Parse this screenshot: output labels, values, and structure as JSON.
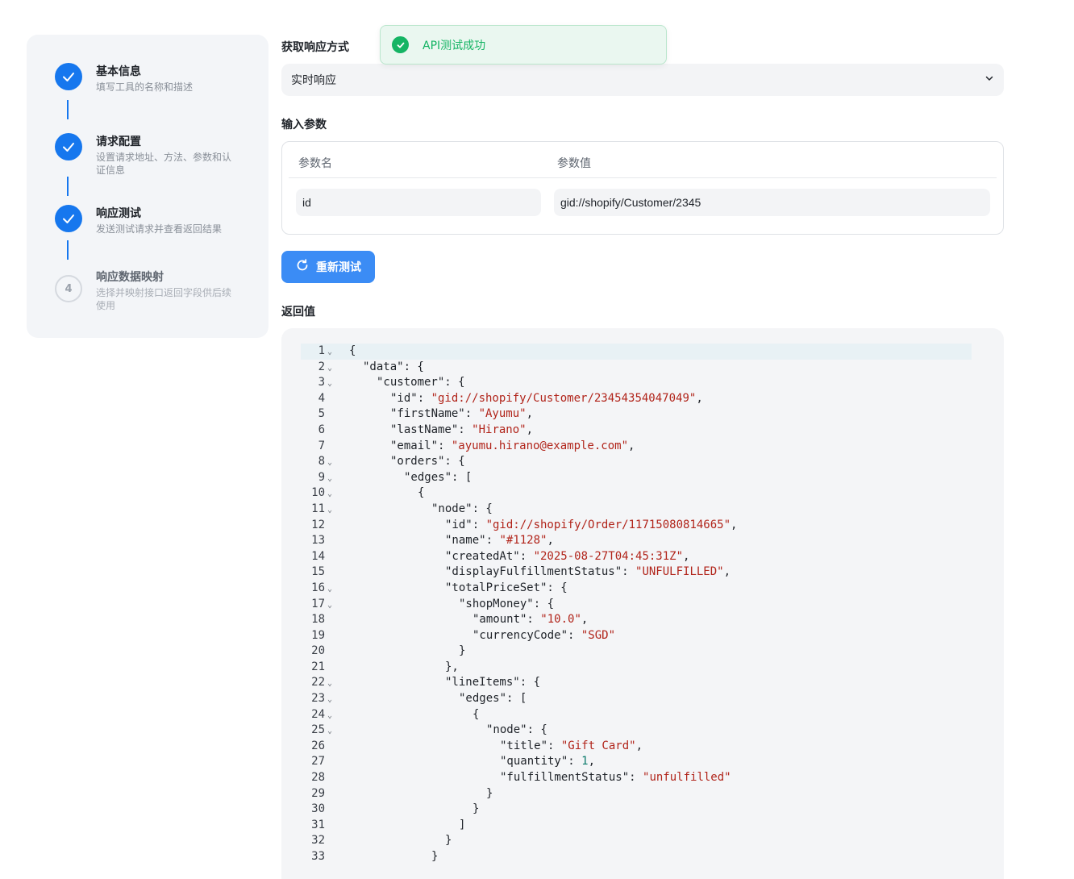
{
  "steps": [
    {
      "title": "基本信息",
      "desc": "填写工具的名称和描述",
      "status": "done"
    },
    {
      "title": "请求配置",
      "desc": "设置请求地址、方法、参数和认证信息",
      "status": "done"
    },
    {
      "title": "响应测试",
      "desc": "发送测试请求并查看返回结果",
      "status": "done"
    },
    {
      "title": "响应数据映射",
      "desc": "选择并映射接口返回字段供后续使用",
      "status": "pending",
      "number": "4"
    }
  ],
  "toast": {
    "message": "API测试成功"
  },
  "response_mode": {
    "label": "获取响应方式",
    "value": "实时响应"
  },
  "params": {
    "label": "输入参数",
    "col_name": "参数名",
    "col_value": "参数值",
    "rows": [
      {
        "name": "id",
        "value": "gid://shopify/Customer/2345"
      }
    ]
  },
  "retest_button": "重新测试",
  "result": {
    "label": "返回值",
    "lines": [
      {
        "n": "1",
        "fold": true,
        "indent": 0,
        "parts": [
          {
            "t": "{"
          }
        ]
      },
      {
        "n": "2",
        "fold": true,
        "indent": 1,
        "parts": [
          {
            "t": "\"data\": {"
          }
        ]
      },
      {
        "n": "3",
        "fold": true,
        "indent": 2,
        "parts": [
          {
            "t": "\"customer\": {"
          }
        ]
      },
      {
        "n": "4",
        "indent": 3,
        "parts": [
          {
            "t": "\"id\": "
          },
          {
            "t": "\"gid://shopify/Customer/23454354047049\"",
            "c": "s"
          },
          {
            "t": ","
          }
        ]
      },
      {
        "n": "5",
        "indent": 3,
        "parts": [
          {
            "t": "\"firstName\": "
          },
          {
            "t": "\"Ayumu\"",
            "c": "s"
          },
          {
            "t": ","
          }
        ]
      },
      {
        "n": "6",
        "indent": 3,
        "parts": [
          {
            "t": "\"lastName\": "
          },
          {
            "t": "\"Hirano\"",
            "c": "s"
          },
          {
            "t": ","
          }
        ]
      },
      {
        "n": "7",
        "indent": 3,
        "parts": [
          {
            "t": "\"email\": "
          },
          {
            "t": "\"ayumu.hirano@example.com\"",
            "c": "s"
          },
          {
            "t": ","
          }
        ]
      },
      {
        "n": "8",
        "fold": true,
        "indent": 3,
        "parts": [
          {
            "t": "\"orders\": {"
          }
        ]
      },
      {
        "n": "9",
        "fold": true,
        "indent": 4,
        "parts": [
          {
            "t": "\"edges\": ["
          }
        ]
      },
      {
        "n": "10",
        "fold": true,
        "indent": 5,
        "parts": [
          {
            "t": "{"
          }
        ]
      },
      {
        "n": "11",
        "fold": true,
        "indent": 6,
        "parts": [
          {
            "t": "\"node\": {"
          }
        ]
      },
      {
        "n": "12",
        "indent": 7,
        "parts": [
          {
            "t": "\"id\": "
          },
          {
            "t": "\"gid://shopify/Order/11715080814665\"",
            "c": "s"
          },
          {
            "t": ","
          }
        ]
      },
      {
        "n": "13",
        "indent": 7,
        "parts": [
          {
            "t": "\"name\": "
          },
          {
            "t": "\"#1128\"",
            "c": "s"
          },
          {
            "t": ","
          }
        ]
      },
      {
        "n": "14",
        "indent": 7,
        "parts": [
          {
            "t": "\"createdAt\": "
          },
          {
            "t": "\"2025-08-27T04:45:31Z\"",
            "c": "s"
          },
          {
            "t": ","
          }
        ]
      },
      {
        "n": "15",
        "indent": 7,
        "parts": [
          {
            "t": "\"displayFulfillmentStatus\": "
          },
          {
            "t": "\"UNFULFILLED\"",
            "c": "s"
          },
          {
            "t": ","
          }
        ]
      },
      {
        "n": "16",
        "fold": true,
        "indent": 7,
        "parts": [
          {
            "t": "\"totalPriceSet\": {"
          }
        ]
      },
      {
        "n": "17",
        "fold": true,
        "indent": 8,
        "parts": [
          {
            "t": "\"shopMoney\": {"
          }
        ]
      },
      {
        "n": "18",
        "indent": 9,
        "parts": [
          {
            "t": "\"amount\": "
          },
          {
            "t": "\"10.0\"",
            "c": "s"
          },
          {
            "t": ","
          }
        ]
      },
      {
        "n": "19",
        "indent": 9,
        "parts": [
          {
            "t": "\"currencyCode\": "
          },
          {
            "t": "\"SGD\"",
            "c": "s"
          }
        ]
      },
      {
        "n": "20",
        "indent": 8,
        "parts": [
          {
            "t": "}"
          }
        ]
      },
      {
        "n": "21",
        "indent": 7,
        "parts": [
          {
            "t": "},"
          }
        ]
      },
      {
        "n": "22",
        "fold": true,
        "indent": 7,
        "parts": [
          {
            "t": "\"lineItems\": {"
          }
        ]
      },
      {
        "n": "23",
        "fold": true,
        "indent": 8,
        "parts": [
          {
            "t": "\"edges\": ["
          }
        ]
      },
      {
        "n": "24",
        "fold": true,
        "indent": 9,
        "parts": [
          {
            "t": "{"
          }
        ]
      },
      {
        "n": "25",
        "fold": true,
        "indent": 10,
        "parts": [
          {
            "t": "\"node\": {"
          }
        ]
      },
      {
        "n": "26",
        "indent": 11,
        "parts": [
          {
            "t": "\"title\": "
          },
          {
            "t": "\"Gift Card\"",
            "c": "s"
          },
          {
            "t": ","
          }
        ]
      },
      {
        "n": "27",
        "indent": 11,
        "parts": [
          {
            "t": "\"quantity\": "
          },
          {
            "t": "1",
            "c": "n"
          },
          {
            "t": ","
          }
        ]
      },
      {
        "n": "28",
        "indent": 11,
        "parts": [
          {
            "t": "\"fulfillmentStatus\": "
          },
          {
            "t": "\"unfulfilled\"",
            "c": "s"
          }
        ]
      },
      {
        "n": "29",
        "indent": 10,
        "parts": [
          {
            "t": "}"
          }
        ]
      },
      {
        "n": "30",
        "indent": 9,
        "parts": [
          {
            "t": "}"
          }
        ]
      },
      {
        "n": "31",
        "indent": 8,
        "parts": [
          {
            "t": "]"
          }
        ]
      },
      {
        "n": "32",
        "indent": 7,
        "parts": [
          {
            "t": "}"
          }
        ]
      },
      {
        "n": "33",
        "indent": 6,
        "parts": [
          {
            "t": "}"
          }
        ]
      }
    ]
  }
}
